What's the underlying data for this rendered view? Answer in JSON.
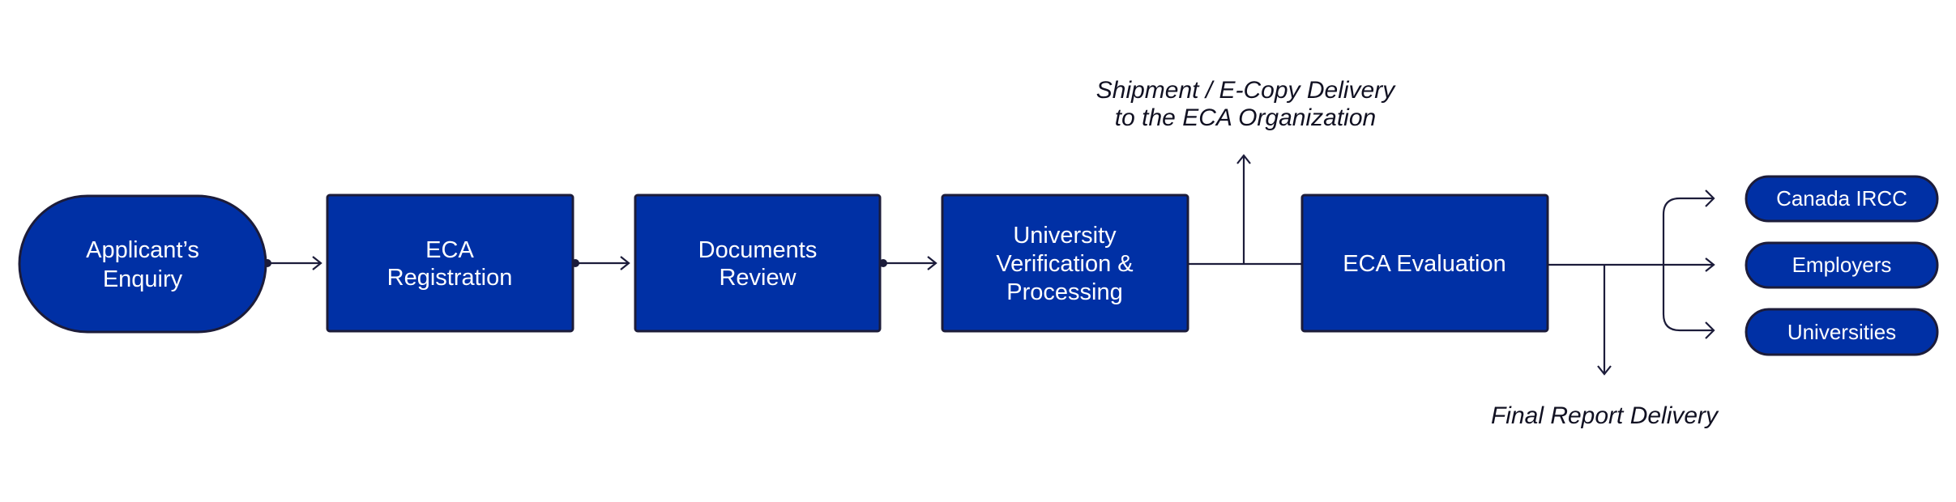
{
  "colors": {
    "node_fill": "#0030a5",
    "node_stroke": "#1c1c3a",
    "connector": "#1c1c3a",
    "label_text": "#ffffff"
  },
  "nodes": [
    {
      "id": "enquiry",
      "shape": "terminator",
      "lines": [
        "Applicant’s",
        "Enquiry"
      ]
    },
    {
      "id": "registration",
      "shape": "process",
      "lines": [
        "ECA",
        "Registration"
      ]
    },
    {
      "id": "review",
      "shape": "process",
      "lines": [
        "Documents",
        "Review"
      ]
    },
    {
      "id": "verification",
      "shape": "process",
      "lines": [
        "University",
        "Verification &",
        "Processing"
      ]
    },
    {
      "id": "evaluation",
      "shape": "process",
      "lines": [
        "ECA Evaluation"
      ]
    }
  ],
  "recipients": [
    "Canada IRCC",
    "Employers",
    "Universities"
  ],
  "annotations": {
    "shipment": [
      "Shipment / E-Copy Delivery",
      "to the ECA Organization"
    ],
    "final_report": "Final Report Delivery"
  }
}
